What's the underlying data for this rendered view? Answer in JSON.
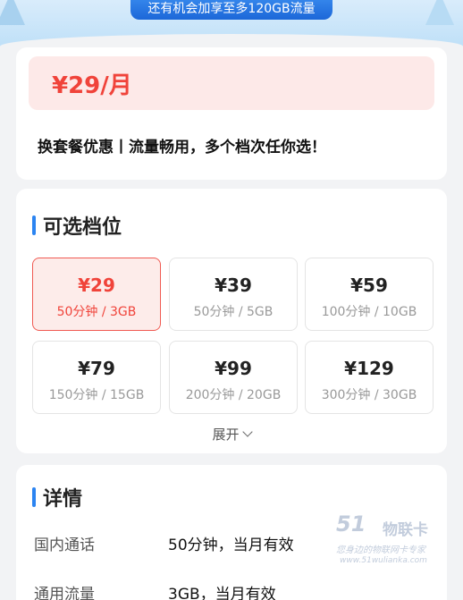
{
  "banner": {
    "text": "还有机会加享至多120GB流量"
  },
  "plan": {
    "price": "¥29/月",
    "promo": "换套餐优惠丨流量畅用，多个档次任你选！"
  },
  "tiers": {
    "title": "可选档位",
    "selected_index": 0,
    "items": [
      {
        "price": "¥29",
        "spec": "50分钟 / 3GB"
      },
      {
        "price": "¥39",
        "spec": "50分钟 / 5GB"
      },
      {
        "price": "¥59",
        "spec": "100分钟 / 10GB"
      },
      {
        "price": "¥79",
        "spec": "150分钟 / 15GB"
      },
      {
        "price": "¥99",
        "spec": "200分钟 / 20GB"
      },
      {
        "price": "¥129",
        "spec": "300分钟 / 30GB"
      }
    ],
    "expand_label": "展开"
  },
  "details": {
    "title": "详情",
    "rows": [
      {
        "label": "国内通话",
        "value": "50分钟，当月有效"
      },
      {
        "label": "通用流量",
        "value": "3GB，当月有效"
      }
    ]
  },
  "watermark": {
    "logo": "51",
    "name": "物联卡",
    "slogan": "您身边的物联网卡专家",
    "url": "www.51wulianka.com"
  },
  "colors": {
    "accent_red": "#f0433a",
    "accent_blue": "#2b84f1",
    "selected_bg": "#fdecea"
  }
}
